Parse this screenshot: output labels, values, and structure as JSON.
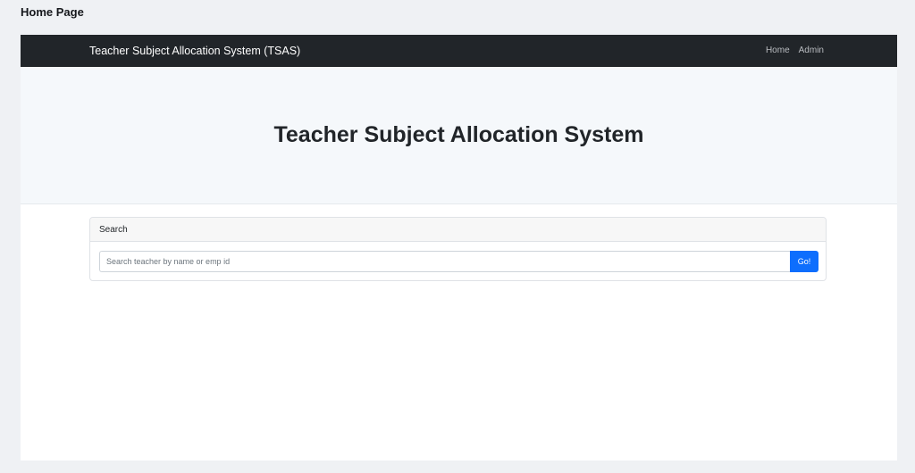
{
  "frame": {
    "label": "Home Page"
  },
  "navbar": {
    "brand": "Teacher Subject Allocation System (TSAS)",
    "links": [
      {
        "label": "Home"
      },
      {
        "label": "Admin"
      }
    ],
    "background": "#212529"
  },
  "hero": {
    "title": "Teacher Subject Allocation System"
  },
  "search": {
    "header": "Search",
    "placeholder": "Search teacher by name or emp id",
    "value": "",
    "button_label": "Go!",
    "button_color": "#0d6efd"
  }
}
